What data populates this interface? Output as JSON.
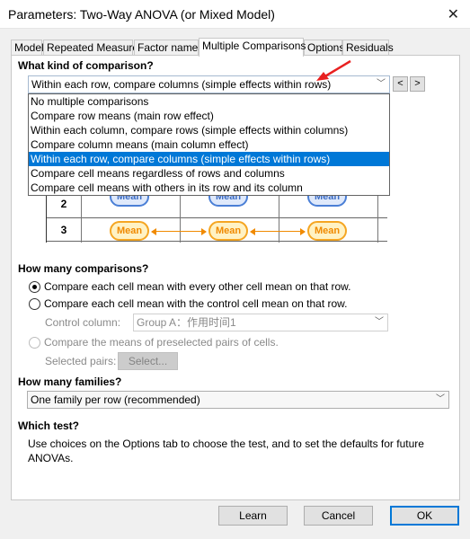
{
  "window": {
    "title": "Parameters: Two-Way ANOVA (or Mixed Model)"
  },
  "tabs": [
    {
      "label": "Model"
    },
    {
      "label": "Repeated Measures"
    },
    {
      "label": "Factor names"
    },
    {
      "label": "Multiple Comparisons",
      "active": true
    },
    {
      "label": "Options"
    },
    {
      "label": "Residuals"
    }
  ],
  "comparison": {
    "heading": "What kind of comparison?",
    "selected": "Within each row, compare columns (simple effects within rows)",
    "prev_label": "<",
    "next_label": ">",
    "options": [
      "No multiple comparisons",
      "Compare row means (main row effect)",
      "Within each column, compare rows (simple effects within columns)",
      "Compare column means (main column effect)",
      "Within each row, compare columns (simple effects within rows)",
      "Compare cell means regardless of rows and columns",
      "Compare cell means with others in its row and its column"
    ]
  },
  "diagram": {
    "rows": [
      "2",
      "3"
    ],
    "mean_label": "Mean"
  },
  "how_many": {
    "heading": "How many comparisons?",
    "option1": "Compare each cell mean with every other cell mean on that row.",
    "option2": "Compare each cell mean with the control cell mean on that row.",
    "control_label": "Control column:",
    "control_value": "Group A：作用时间1",
    "option3": "Compare the means of preselected pairs of cells.",
    "pairs_label": "Selected pairs:",
    "select_button": "Select..."
  },
  "families": {
    "heading": "How many families?",
    "value": "One family per row (recommended)"
  },
  "test": {
    "heading": "Which test?",
    "text_line1": "Use choices on the Options tab to choose the test, and to set the defaults for future",
    "text_line2": "ANOVAs."
  },
  "buttons": {
    "learn": "Learn",
    "cancel": "Cancel",
    "ok": "OK"
  },
  "colors": {
    "accent": "#0078d7",
    "mean_orange": "#f5a623",
    "mean_blue": "#4a7fd6"
  }
}
